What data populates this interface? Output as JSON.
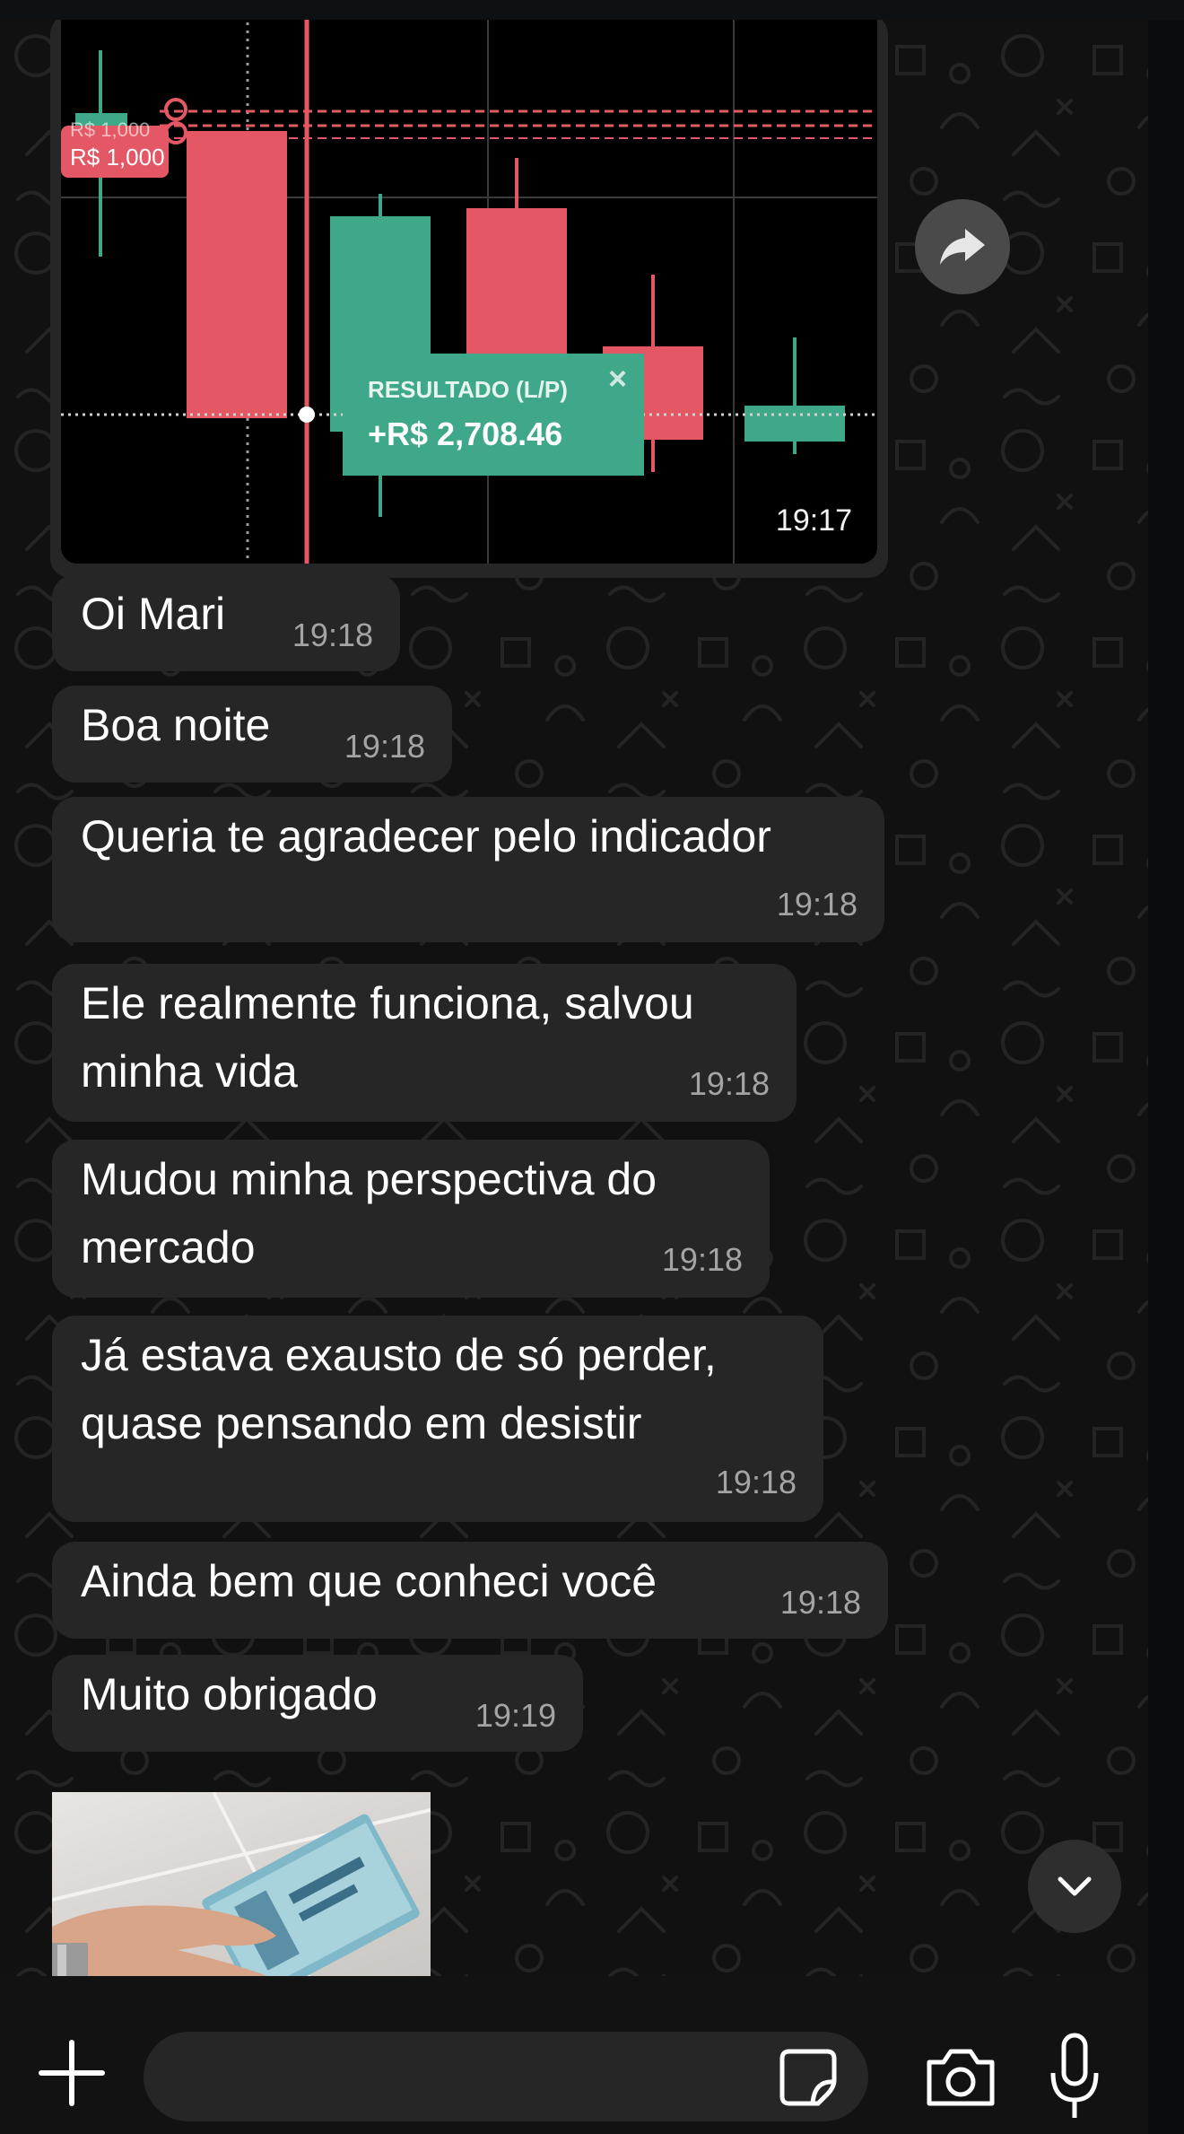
{
  "chart_message": {
    "stop_label": "R$ 1,000",
    "stop_label_ghost": "R$ 1,000",
    "result_title": "RESULTADO (L/P)",
    "result_value": "+R$ 2,708.46",
    "close_glyph": "×",
    "time": "19:17"
  },
  "messages": [
    {
      "text": "Oi Mari",
      "time": "19:18"
    },
    {
      "text": "Boa noite",
      "time": "19:18"
    },
    {
      "text": "Queria te agradecer pelo indicador",
      "time": "19:18"
    },
    {
      "text": "Ele realmente funciona, salvou\nminha vida",
      "time": "19:18"
    },
    {
      "text": "Mudou minha perspectiva do\nmercado",
      "time": "19:18"
    },
    {
      "text": "Já estava exausto de só perder,\nquase pensando em desistir",
      "time": "19:18"
    },
    {
      "text": "Ainda bem que conheci você",
      "time": "19:18"
    },
    {
      "text": "Muito obrigado",
      "time": "19:19"
    }
  ],
  "icons": {
    "forward": "forward-arrow-icon",
    "scroll_down": "chevron-down-icon",
    "attach": "plus-icon",
    "sticker": "sticker-icon",
    "camera": "camera-icon",
    "mic": "microphone-icon"
  },
  "colors": {
    "bubble": "#262626",
    "bear_candle": "#e45764",
    "bull_candle": "#3fa88a",
    "chat_background": "#111111",
    "timestamp": "#a4a4a4"
  }
}
